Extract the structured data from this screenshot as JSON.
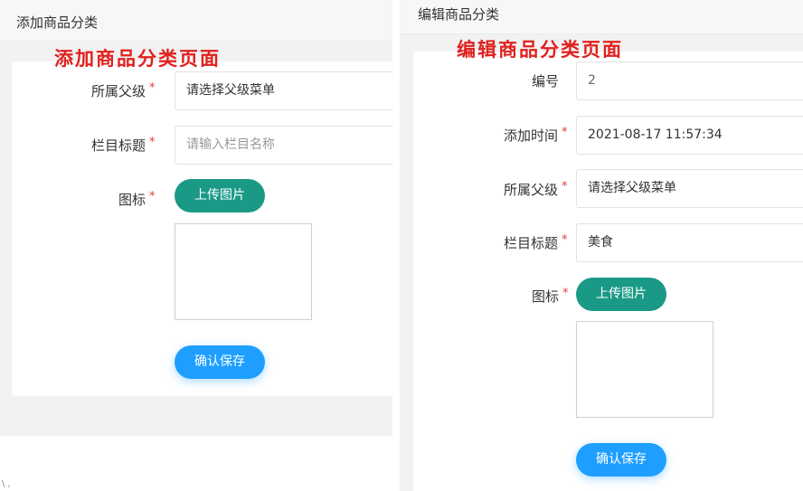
{
  "add": {
    "tab_title": "添加商品分类",
    "annotation": "添加商品分类页面",
    "parent": {
      "label": "所属父级",
      "value": "请选择父级菜单"
    },
    "title_field": {
      "label": "栏目标题",
      "placeholder": "请输入栏目名称"
    },
    "icon": {
      "label": "图标",
      "upload_label": "上传图片"
    },
    "save_label": "确认保存",
    "required_mark": "*"
  },
  "edit": {
    "tab_title": "编辑商品分类",
    "annotation": "编辑商品分类页面",
    "id": {
      "label": "编号",
      "value": "2"
    },
    "created": {
      "label": "添加时间",
      "value": "2021-08-17 11:57:34"
    },
    "parent": {
      "label": "所属父级",
      "value": "请选择父级菜单"
    },
    "title_field": {
      "label": "栏目标题",
      "value": "美食"
    },
    "icon": {
      "label": "图标",
      "upload_label": "上传图片"
    },
    "save_label": "确认保存",
    "required_mark": "*"
  },
  "stray_mark": "\\ ,",
  "colors": {
    "upload": "#1a9a86",
    "save": "#1e9fff",
    "required": "#e23b3b",
    "annotation": "#e0211e"
  }
}
